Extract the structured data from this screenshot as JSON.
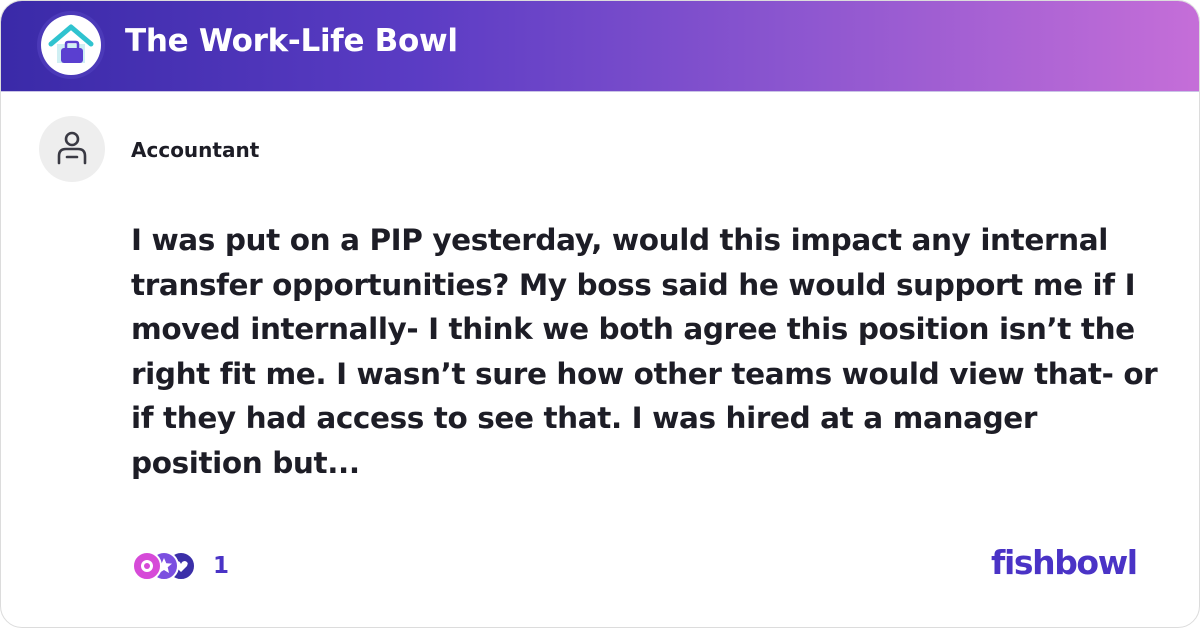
{
  "header": {
    "bowl_name": "The Work-Life Bowl",
    "logo_icon": "house-briefcase-icon",
    "gradient_start": "#3a2aa8",
    "gradient_end": "#c56ed8"
  },
  "post": {
    "author": "Accountant",
    "avatar_icon": "anonymous-user-icon",
    "text": "I was put on a PIP yesterday, would this impact any internal transfer opportunities? My boss said he would support me if I moved internally- I think we both agree this position isn’t the right fit me. I wasn’t sure how other teams would view that- or if they had access to see that. I was hired at a manager position but...",
    "reaction_icons": [
      "like-reaction-icon",
      "star-reaction-icon",
      "heart-reaction-icon"
    ],
    "reaction_count": "1"
  },
  "brand": {
    "wordmark": "fishbowl",
    "color": "#4a33c6"
  }
}
